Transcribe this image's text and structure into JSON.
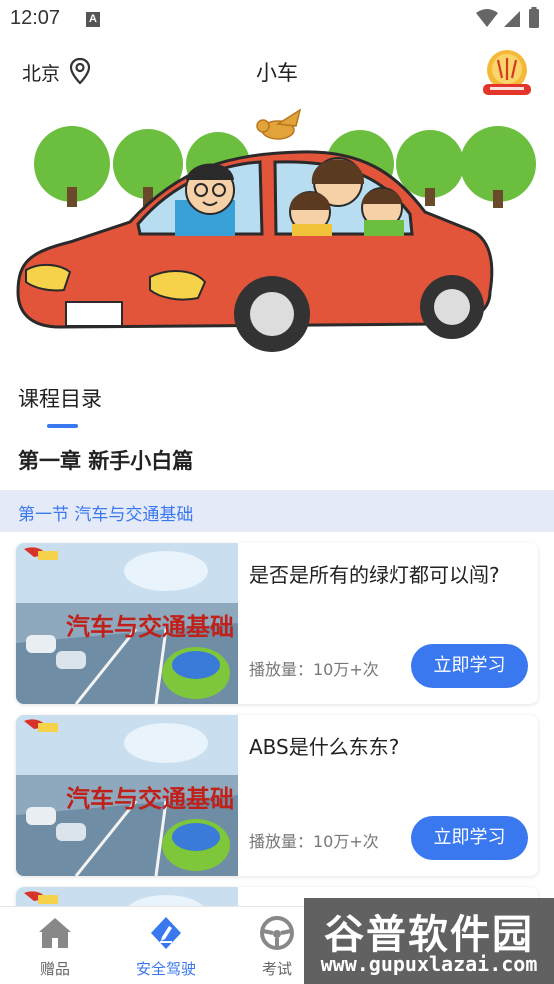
{
  "status_bar": {
    "time": "12:07",
    "notification_letter": "A",
    "icons": [
      "wifi-icon",
      "signal-icon",
      "battery-icon"
    ]
  },
  "header": {
    "city": "北京",
    "title": "小车",
    "badge_icon": "promo-badge-icon"
  },
  "course": {
    "tab_label": "课程目录",
    "chapter_title": "第一章 新手小白篇",
    "section_title": "第一节 汽车与交通基础",
    "thumbnail_text": "汽车与交通基础",
    "lessons": [
      {
        "title": "是否是所有的绿灯都可以闯?",
        "plays": "播放量：10万+次",
        "button": "立即学习"
      },
      {
        "title": "ABS是什么东东?",
        "plays": "播放量：10万+次",
        "button": "立即学习"
      }
    ]
  },
  "bottom_nav": {
    "items": [
      {
        "label": "赠品",
        "icon": "home-icon"
      },
      {
        "label": "安全驾驶",
        "icon": "safe-driving-icon"
      },
      {
        "label": "考试",
        "icon": "steering-wheel-icon"
      }
    ]
  },
  "watermark": {
    "line1": "谷普软件园",
    "line2": "www.gupuxlazai.com"
  },
  "colors": {
    "accent": "#3a78f0",
    "section_bg": "#e4eaf7",
    "car_red": "#e2553a"
  }
}
